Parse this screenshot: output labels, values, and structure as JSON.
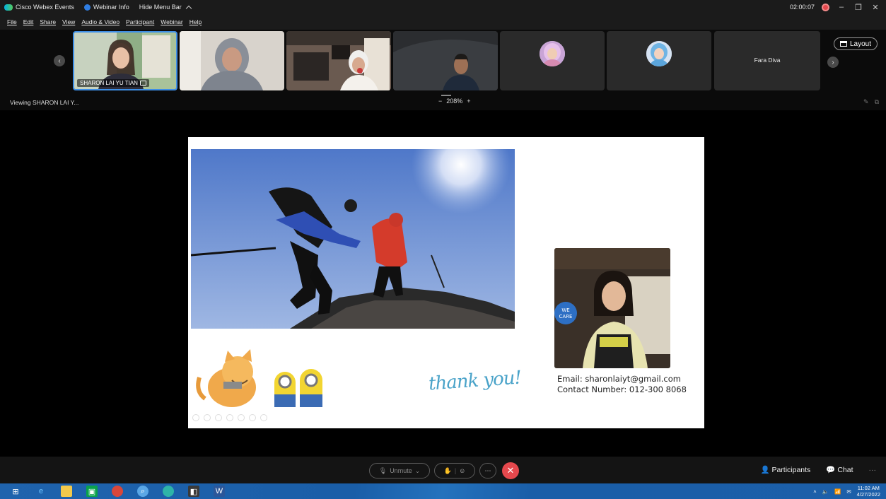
{
  "titlebar": {
    "app_name": "Cisco Webex Events",
    "webinar_info": "Webinar Info",
    "hide_menu": "Hide Menu Bar",
    "timer": "02:00:07"
  },
  "menu": [
    "File",
    "Edit",
    "Share",
    "View",
    "Audio & Video",
    "Participant",
    "Webinar",
    "Help"
  ],
  "participants_strip": {
    "active_name": "SHARON LAI YU TIAN",
    "tiles": [
      {
        "name": "SHARON LAI YU TIAN",
        "type": "video"
      },
      {
        "name": "",
        "type": "video"
      },
      {
        "name": "",
        "type": "video"
      },
      {
        "name": "",
        "type": "video"
      },
      {
        "name": "",
        "type": "avatar"
      },
      {
        "name": "",
        "type": "avatar"
      },
      {
        "name": "Fara Diva",
        "type": "name-only"
      }
    ],
    "layout_label": "Layout"
  },
  "viewbar": {
    "viewing": "Viewing SHARON LAI Y...",
    "zoom_minus": "−",
    "zoom_level": "208%",
    "zoom_plus": "+"
  },
  "slide": {
    "thank_you": "thank you!",
    "email": "Email: sharonlaiyt@gmail.com",
    "contact": "Contact Number: 012-300 8068",
    "badge": "WE CARE"
  },
  "controls": {
    "unmute": "Unmute",
    "participants": "Participants",
    "chat": "Chat",
    "more": "···"
  },
  "taskbar": {
    "time": "11:02 AM",
    "date": "4/27/2022"
  },
  "colors": {
    "accent_blue": "#3d8ee6",
    "end_call_red": "#e5484d",
    "taskbar_blue": "#1a5ea8"
  }
}
